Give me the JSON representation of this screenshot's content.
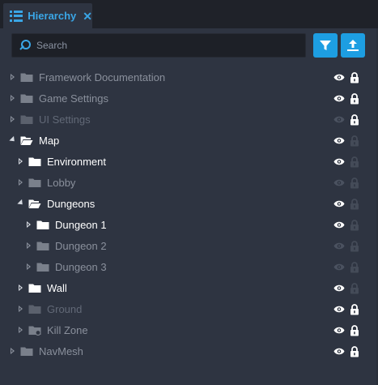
{
  "tab": {
    "title": "Hierarchy",
    "close": "✕"
  },
  "search": {
    "placeholder": "Search"
  },
  "colors": {
    "accent": "#1d9ee2",
    "panel": "#2e3441",
    "bright": "#ffffff",
    "dim": "#7b8290",
    "dimmer": "#5a6170"
  },
  "tree": [
    {
      "label": "Framework Documentation",
      "depth": 0,
      "state": "collapsed",
      "tone": "dim",
      "visible": true,
      "locked": true,
      "icon": "folder-icon"
    },
    {
      "label": "Game Settings",
      "depth": 0,
      "state": "collapsed",
      "tone": "dim",
      "visible": true,
      "locked": true,
      "icon": "folder-icon"
    },
    {
      "label": "UI Settings",
      "depth": 0,
      "state": "collapsed",
      "tone": "dimmer",
      "visible": false,
      "locked": true,
      "icon": "folder-icon"
    },
    {
      "label": "Map",
      "depth": 0,
      "state": "expanded",
      "tone": "bright",
      "visible": true,
      "locked": false,
      "icon": "folder-open-icon"
    },
    {
      "label": "Environment",
      "depth": 1,
      "state": "collapsed",
      "tone": "bright",
      "visible": true,
      "locked": false,
      "icon": "folder-icon"
    },
    {
      "label": "Lobby",
      "depth": 1,
      "state": "collapsed",
      "tone": "dim",
      "visible": false,
      "locked": false,
      "icon": "folder-icon"
    },
    {
      "label": "Dungeons",
      "depth": 1,
      "state": "expanded",
      "tone": "bright",
      "visible": true,
      "locked": false,
      "icon": "folder-open-icon"
    },
    {
      "label": "Dungeon 1",
      "depth": 2,
      "state": "collapsed",
      "tone": "bright",
      "visible": true,
      "locked": false,
      "icon": "folder-icon"
    },
    {
      "label": "Dungeon 2",
      "depth": 2,
      "state": "collapsed",
      "tone": "dim",
      "visible": false,
      "locked": false,
      "icon": "folder-icon"
    },
    {
      "label": "Dungeon 3",
      "depth": 2,
      "state": "collapsed",
      "tone": "dim",
      "visible": false,
      "locked": false,
      "icon": "folder-icon"
    },
    {
      "label": "Wall",
      "depth": 1,
      "state": "collapsed",
      "tone": "bright",
      "visible": true,
      "locked": false,
      "icon": "folder-icon"
    },
    {
      "label": "Ground",
      "depth": 1,
      "state": "collapsed",
      "tone": "dimmer",
      "visible": true,
      "locked": true,
      "icon": "folder-icon"
    },
    {
      "label": "Kill Zone",
      "depth": 1,
      "state": "collapsed",
      "tone": "dim",
      "visible": true,
      "locked": true,
      "icon": "trigger-folder-icon"
    },
    {
      "label": "NavMesh",
      "depth": 0,
      "state": "collapsed",
      "tone": "dim",
      "visible": true,
      "locked": true,
      "icon": "folder-icon"
    }
  ]
}
